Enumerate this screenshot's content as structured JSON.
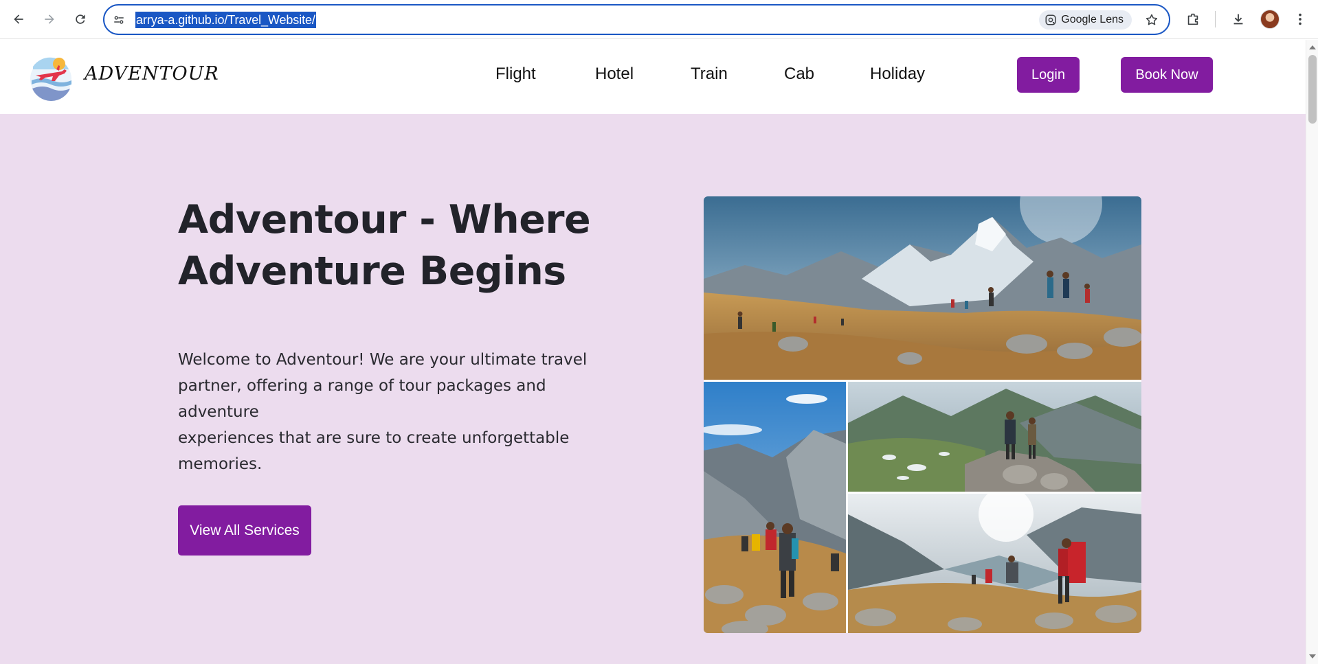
{
  "browser": {
    "url": "arrya-a.github.io/Travel_Website/",
    "lens_label": "Google Lens"
  },
  "site": {
    "brand": "ADVENTOUR",
    "nav": [
      {
        "label": "Flight"
      },
      {
        "label": "Hotel"
      },
      {
        "label": "Train"
      },
      {
        "label": "Cab"
      },
      {
        "label": "Holiday"
      }
    ],
    "login_label": "Login",
    "book_label": "Book Now"
  },
  "hero": {
    "title_line1": "Adventour - Where",
    "title_line2": "Adventure Begins",
    "text_line1": "Welcome to Adventour! We are your ultimate travel",
    "text_line2": "partner, offering a range of tour packages and adventure",
    "text_line3": "experiences that are sure to create unforgettable",
    "text_line4": "memories.",
    "cta_label": "View All Services"
  },
  "colors": {
    "accent": "#821ca0",
    "hero_bg": "#ecdcee",
    "heading": "#22232a"
  },
  "icons": [
    "back-icon",
    "forward-icon",
    "reload-icon",
    "site-info-icon",
    "google-lens-icon",
    "bookmark-star-icon",
    "extensions-icon",
    "download-icon",
    "menu-dots-icon"
  ]
}
